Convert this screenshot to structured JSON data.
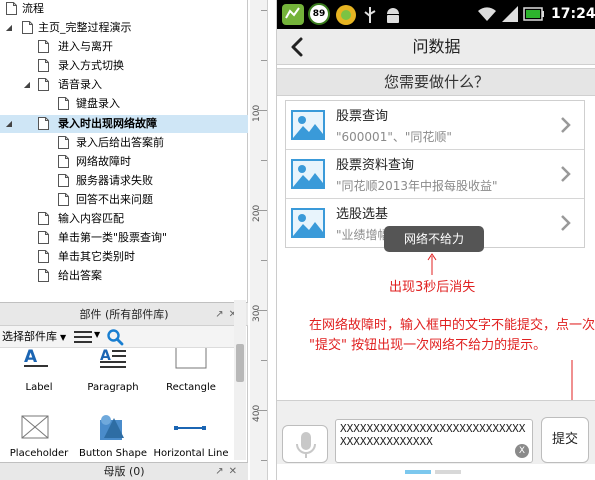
{
  "sitemap": {
    "items": [
      {
        "label": "流程"
      },
      {
        "label": "主页_完整过程演示"
      },
      {
        "label": "进入与离开"
      },
      {
        "label": "录入方式切换"
      },
      {
        "label": "语音录入"
      },
      {
        "label": "键盘录入"
      },
      {
        "label": "录入时出现网络故障"
      },
      {
        "label": "录入后给出答案前"
      },
      {
        "label": "网络故障时"
      },
      {
        "label": "服务器请求失败"
      },
      {
        "label": "回答不出来问题"
      },
      {
        "label": "输入内容匹配"
      },
      {
        "label": "单击第一类\"股票查询\""
      },
      {
        "label": "单击其它类别时"
      },
      {
        "label": "给出答案"
      }
    ]
  },
  "widgets_panel": {
    "title": "部件 (所有部件库)",
    "library_select": "选择部件库",
    "items": [
      {
        "label": "Label"
      },
      {
        "label": "Paragraph"
      },
      {
        "label": "Rectangle"
      },
      {
        "label": "Placeholder"
      },
      {
        "label": "Button Shape"
      },
      {
        "label": "Horizontal Line"
      }
    ]
  },
  "masters_panel": {
    "title": "母版 (0)"
  },
  "ruler": {
    "labels": [
      "100",
      "200",
      "300",
      "400"
    ]
  },
  "phone": {
    "status": {
      "badge": "89",
      "time": "17:24"
    },
    "nav": {
      "title": "问数据"
    },
    "question": "您需要做什么？",
    "cards": [
      {
        "title": "股票查询",
        "subtitle": "\"600001\"、\"同花顺\""
      },
      {
        "title": "股票资料查询",
        "subtitle": "\"同花顺2013年中报每股收益\""
      },
      {
        "title": "选股选基",
        "subtitle": "\"业绩增幅\"                         \""
      }
    ],
    "toast": "网络不给力",
    "annotation1": "出现3秒后消失",
    "annotation2": "在网络故障时，输入框中的文字不能提交，点一次 \"提交\" 按钮出现一次网络不给力的提示。",
    "input_value": "XXXXXXXXXXXXXXXXXXXXXXXXXXXXXXXXXXXXXXXXXX",
    "clear_label": "X",
    "submit_label": "提交"
  },
  "colors": {
    "selected_row": "#cfe6f6",
    "annotation": "#e02020",
    "toast_bg": "#555555",
    "icon_blue": "#3a9ad9"
  }
}
